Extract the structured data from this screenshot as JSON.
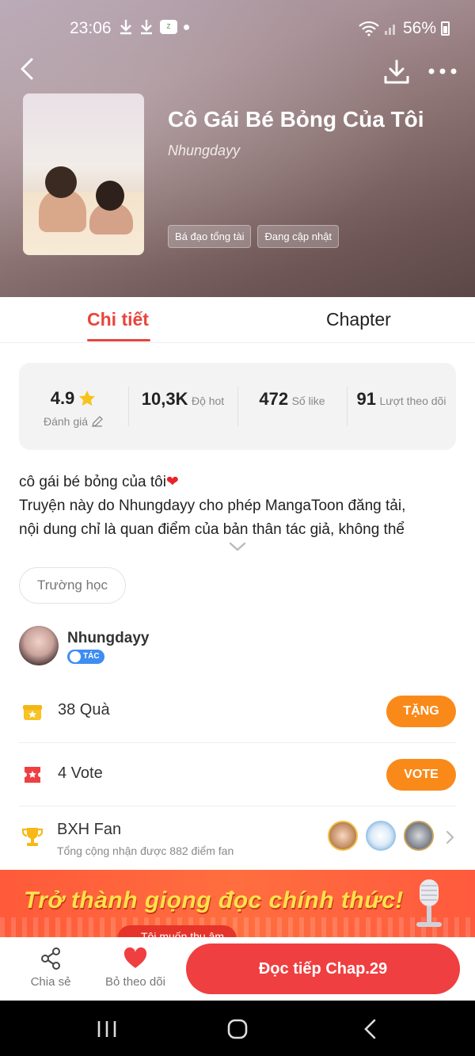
{
  "status_bar": {
    "time": "23:06",
    "battery": "56%"
  },
  "colors": {
    "accent": "#e8453c",
    "orange": "#f98a1a",
    "read_button": "#ef3f41",
    "badge_blue": "#3d8df2"
  },
  "story": {
    "title": "Cô Gái Bé Bỏng Của Tôi",
    "author": "Nhungdayy",
    "tags": [
      "Bá đạo tổng tài",
      "Đang cập nhật"
    ]
  },
  "tabs": [
    {
      "label": "Chi tiết",
      "active": true
    },
    {
      "label": "Chapter",
      "active": false
    }
  ],
  "stats": [
    {
      "value": "4.9",
      "label": "Đánh giá",
      "icon": "star-icon"
    },
    {
      "value": "10,3K",
      "label": "Độ hot"
    },
    {
      "value": "472",
      "label": "Số like"
    },
    {
      "value": "91",
      "label": "Lượt theo dõi"
    }
  ],
  "description": {
    "line1": "cô gái bé bỏng của tôi",
    "line2": "Truyện này do Nhungdayy cho phép MangaToon đăng tải,",
    "line3": "nội dung chỉ là quan điểm của bản thân tác giả, không thể"
  },
  "genre_chip": "Trường học",
  "author_card": {
    "name": "Nhungdayy",
    "badge": "TÁC GIẢ"
  },
  "gifts": {
    "text": "38 Quà",
    "button": "TẶNG"
  },
  "votes": {
    "text": "4 Vote",
    "button": "VOTE"
  },
  "fan_ranking": {
    "title": "BXH Fan",
    "subtitle": "Tổng cộng nhận được 882 điểm fan"
  },
  "banner": {
    "headline": "Trở thành giọng đọc chính thức!",
    "cta": "Tôi muốn thu âm"
  },
  "bottom_bar": {
    "share_label": "Chia sẻ",
    "unfollow_label": "Bỏ theo dõi",
    "read_button": "Đọc tiếp Chap.29"
  }
}
